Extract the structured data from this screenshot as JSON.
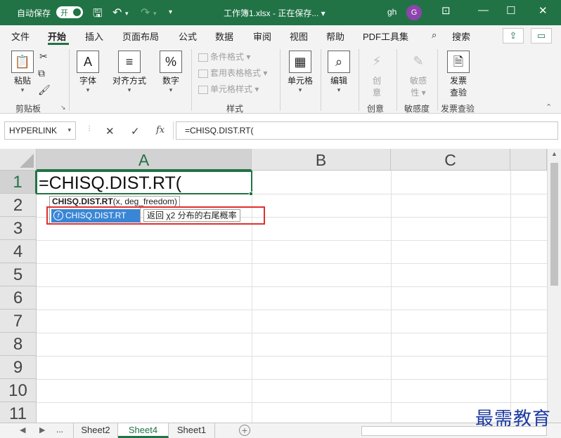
{
  "titlebar": {
    "autosave_label": "自动保存",
    "autosave_state": "开",
    "doc_title": "工作簿1.xlsx - 正在保存... ▾",
    "user_name": "gh",
    "avatar_letter": "G",
    "icons": [
      "save-icon",
      "undo-icon",
      "redo-icon",
      "customize-icon",
      "ribbon-display-icon",
      "minimize-icon",
      "maximize-icon",
      "close-icon"
    ]
  },
  "menu": {
    "tabs": [
      "文件",
      "开始",
      "插入",
      "页面布局",
      "公式",
      "数据",
      "审阅",
      "视图",
      "帮助",
      "PDF工具集",
      "搜索"
    ],
    "active": "开始"
  },
  "ribbon": {
    "paste": "粘贴",
    "clipboard_group": "剪贴板",
    "font": "字体",
    "align": "对齐方式",
    "number": "数字",
    "styles_group": "样式",
    "style_items": [
      "条件格式 ▾",
      "套用表格格式 ▾",
      "单元格样式 ▾"
    ],
    "cells": "单元格",
    "edit": "编辑",
    "creative_btn": [
      "创",
      "意"
    ],
    "creative_group": "创意",
    "sensitivity_btn": [
      "敏感",
      "性 ▾"
    ],
    "sensitivity_group": "敏感度",
    "invoice_btn": [
      "发票",
      "查验"
    ],
    "invoice_group": "发票查验"
  },
  "formula_bar": {
    "name_box": "HYPERLINK",
    "cancel": "✕",
    "enter": "✓",
    "fx": "fx",
    "formula": "=CHISQ.DIST.RT("
  },
  "grid": {
    "columns": [
      "A",
      "B",
      "C"
    ],
    "rows": [
      "1",
      "2",
      "3",
      "4",
      "5",
      "6",
      "7",
      "8",
      "9",
      "10",
      "11"
    ],
    "active_cell_text": "=CHISQ.DIST.RT(",
    "tooltip_func": "CHISQ.DIST.RT",
    "tooltip_args": "(x, deg_freedom)",
    "autocomplete_item": "CHISQ.DIST.RT",
    "autocomplete_desc": "返回 χ2 分布的右尾概率"
  },
  "sheets": {
    "nav_more": "...",
    "tabs": [
      "Sheet2",
      "Sheet4",
      "Sheet1"
    ],
    "active": "Sheet4"
  },
  "watermark": "最需教育",
  "colors": {
    "brand": "#217346",
    "highlight": "#3a86d6",
    "annotation": "#e03030"
  }
}
